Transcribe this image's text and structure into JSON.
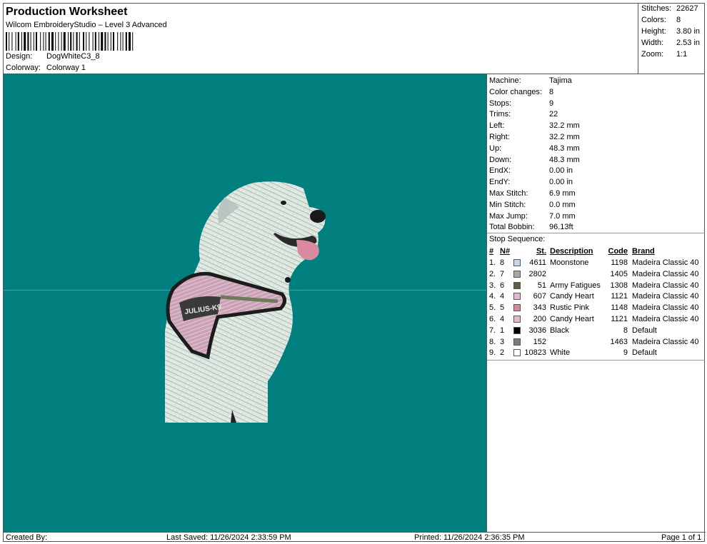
{
  "header": {
    "title": "Production Worksheet",
    "subtitle": "Wilcom EmbroideryStudio – Level 3 Advanced",
    "design_label": "Design:",
    "design_value": "DogWhiteC3_8",
    "colorway_label": "Colorway:",
    "colorway_value": "Colorway 1"
  },
  "stats": [
    {
      "label": "Stitches:",
      "value": "22627"
    },
    {
      "label": "Colors:",
      "value": "8"
    },
    {
      "label": "Height:",
      "value": "3.80 in"
    },
    {
      "label": "Width:",
      "value": "2.53 in"
    },
    {
      "label": "Zoom:",
      "value": "1:1"
    }
  ],
  "machine_info": [
    {
      "label": "Machine:",
      "value": "Tajima"
    },
    {
      "label": "Color changes:",
      "value": "8"
    },
    {
      "label": "Stops:",
      "value": "9"
    },
    {
      "label": "Trims:",
      "value": "22"
    },
    {
      "label": "Left:",
      "value": "32.2 mm"
    },
    {
      "label": "Right:",
      "value": "32.2 mm"
    },
    {
      "label": "Up:",
      "value": "48.3 mm"
    },
    {
      "label": "Down:",
      "value": "48.3 mm"
    },
    {
      "label": "EndX:",
      "value": "0.00 in"
    },
    {
      "label": "EndY:",
      "value": "0.00 in"
    },
    {
      "label": "Max Stitch:",
      "value": "6.9 mm"
    },
    {
      "label": "Min Stitch:",
      "value": "0.0 mm"
    },
    {
      "label": "Max Jump:",
      "value": "7.0 mm"
    },
    {
      "label": "Total Bobbin:",
      "value": "96.13ft"
    }
  ],
  "stop_sequence": {
    "title": "Stop Sequence:",
    "headers": {
      "idx": "#",
      "no": "N#",
      "st": "St.",
      "desc": "Description",
      "code": "Code",
      "brand": "Brand"
    },
    "rows": [
      {
        "idx": "1.",
        "no": "8",
        "color": "#c8d6ea",
        "st": "4611",
        "desc": "Moonstone",
        "code": "1198",
        "brand": "Madeira Classic 40"
      },
      {
        "idx": "2.",
        "no": "7",
        "color": "#a9aaa6",
        "st": "2802",
        "desc": "",
        "code": "1405",
        "brand": "Madeira Classic 40"
      },
      {
        "idx": "3.",
        "no": "6",
        "color": "#5a6048",
        "st": "51",
        "desc": "Army Fatigues",
        "code": "1308",
        "brand": "Madeira Classic 40"
      },
      {
        "idx": "4.",
        "no": "4",
        "color": "#e3b9c9",
        "st": "607",
        "desc": "Candy Heart",
        "code": "1121",
        "brand": "Madeira Classic 40"
      },
      {
        "idx": "5.",
        "no": "5",
        "color": "#d68a98",
        "st": "343",
        "desc": "Rustic Pink",
        "code": "1148",
        "brand": "Madeira Classic 40"
      },
      {
        "idx": "6.",
        "no": "4",
        "color": "#e3b9c9",
        "st": "200",
        "desc": "Candy Heart",
        "code": "1121",
        "brand": "Madeira Classic 40"
      },
      {
        "idx": "7.",
        "no": "1",
        "color": "#000000",
        "st": "3036",
        "desc": "Black",
        "code": "8",
        "brand": "Default"
      },
      {
        "idx": "8.",
        "no": "3",
        "color": "#7a7c78",
        "st": "152",
        "desc": "",
        "code": "1463",
        "brand": "Madeira Classic 40"
      },
      {
        "idx": "9.",
        "no": "2",
        "color": "#ffffff",
        "st": "10823",
        "desc": "White",
        "code": "9",
        "brand": "Default"
      }
    ]
  },
  "design_image": {
    "harness_text": "JULIUS-K9",
    "background_color": "#007f7f"
  },
  "footer": {
    "created_by": "Created By:",
    "last_saved": "Last Saved: 11/26/2024 2:33:59 PM",
    "printed": "Printed: 11/26/2024 2:36:35 PM",
    "page": "Page 1 of 1"
  }
}
